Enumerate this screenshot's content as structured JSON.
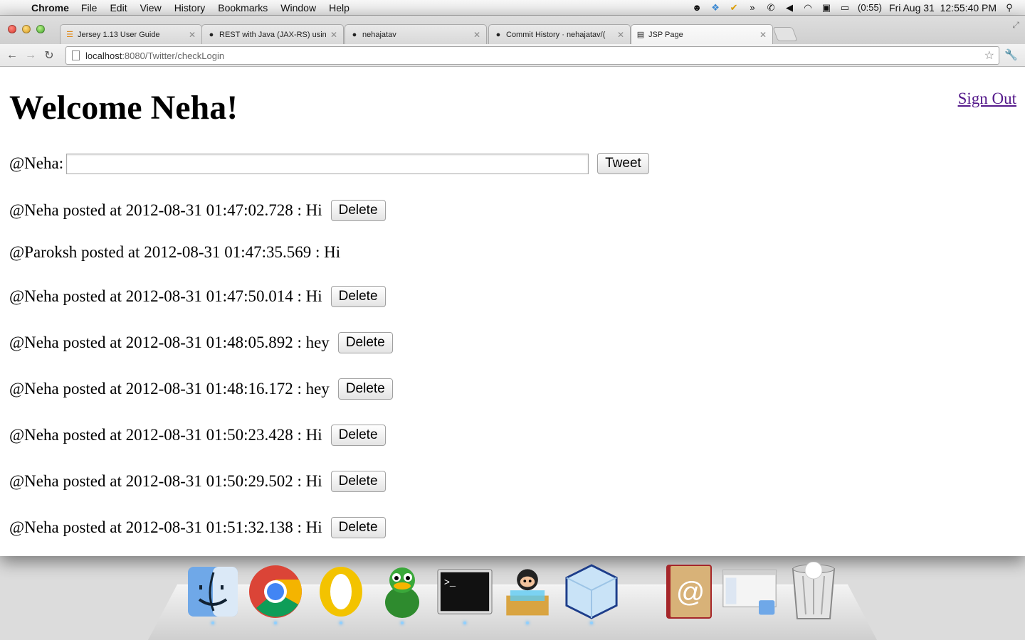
{
  "menubar": {
    "app_name": "Chrome",
    "items": [
      "File",
      "Edit",
      "View",
      "History",
      "Bookmarks",
      "Window",
      "Help"
    ],
    "battery": "(0:55)",
    "clock": "Fri Aug 31  12:55:40 PM"
  },
  "tabs": [
    {
      "title": "Jersey 1.13 User Guide",
      "favicon": "bars-icon"
    },
    {
      "title": "REST with Java (JAX-RS) using",
      "favicon": "github-icon"
    },
    {
      "title": "nehajatav",
      "favicon": "github-icon"
    },
    {
      "title": "Commit History · nehajatav/(",
      "favicon": "github-icon"
    },
    {
      "title": "JSP Page",
      "favicon": "page-icon"
    }
  ],
  "address": {
    "host": "localhost",
    "path": ":8080/Twitter/checkLogin"
  },
  "page": {
    "title": "Welcome Neha!",
    "sign_out": "Sign Out",
    "form_label": "@Neha:",
    "tweet_value": "",
    "tweet_button": "Tweet",
    "delete_label": "Delete",
    "posts": [
      {
        "text": "@Neha posted at 2012-08-31 01:47:02.728 : Hi",
        "deletable": true
      },
      {
        "text": "@Paroksh posted at 2012-08-31 01:47:35.569 : Hi",
        "deletable": false
      },
      {
        "text": "@Neha posted at 2012-08-31 01:47:50.014 : Hi",
        "deletable": true
      },
      {
        "text": "@Neha posted at 2012-08-31 01:48:05.892 : hey",
        "deletable": true
      },
      {
        "text": "@Neha posted at 2012-08-31 01:48:16.172 : hey",
        "deletable": true
      },
      {
        "text": "@Neha posted at 2012-08-31 01:50:23.428 : Hi",
        "deletable": true
      },
      {
        "text": "@Neha posted at 2012-08-31 01:50:29.502 : Hi",
        "deletable": true
      },
      {
        "text": "@Neha posted at 2012-08-31 01:51:32.138 : Hi",
        "deletable": true
      }
    ]
  },
  "dock": [
    "finder-icon",
    "chrome-icon",
    "opera-icon",
    "adium-icon",
    "terminal-icon",
    "github-app-icon",
    "virtualbox-icon",
    "address-book-icon",
    "finder-window-icon",
    "trash-icon"
  ],
  "colors": {
    "link": "#551a8b",
    "dock_indicator": "#8fd0ff"
  }
}
